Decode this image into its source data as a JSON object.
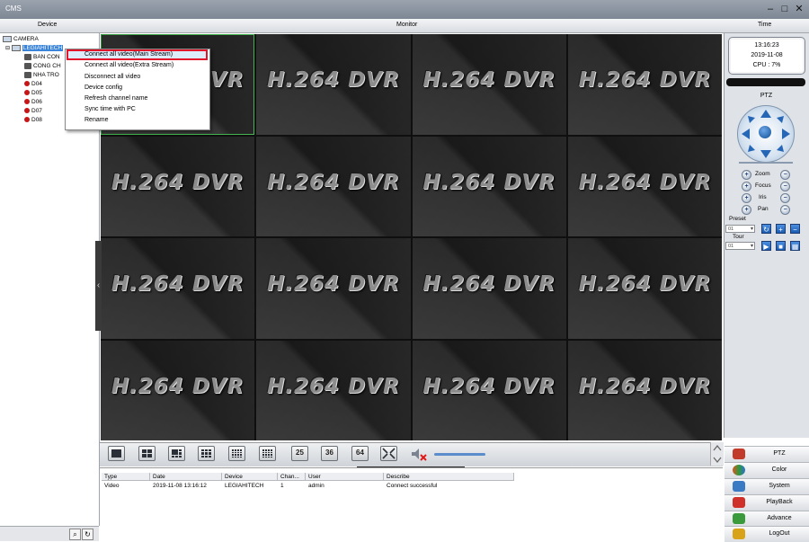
{
  "window": {
    "title": "CMS",
    "controls": {
      "minimize": "–",
      "maximize": "□",
      "close": "✕"
    }
  },
  "header": {
    "device": "Device",
    "monitor": "Monitor",
    "time": "Time"
  },
  "tree": {
    "root": "CAMERA",
    "device": "LEGIAHITECH",
    "channels": [
      "BAN CON",
      "CONG CH",
      "NHA TRO",
      "D04",
      "D05",
      "D06",
      "D07",
      "D08"
    ]
  },
  "context_menu": {
    "items": [
      "Connect all video(Main Stream)",
      "Connect all video(Extra Stream)",
      "Disconnect all video",
      "Device config",
      "Refresh channel name",
      "Sync time with PC",
      "Rename"
    ]
  },
  "video": {
    "placeholder": "H.264 DVR",
    "left_arrow": "‹"
  },
  "layout_buttons": {
    "n25": "25",
    "n36": "36",
    "n64": "64"
  },
  "log": {
    "columns": [
      "Type",
      "Date",
      "Device",
      "Chan...",
      "User",
      "Describe"
    ],
    "rows": [
      {
        "type": "Video",
        "date": "2019-11-08 13:16:12",
        "device": "LEGIAHITECH",
        "channel": "1",
        "user": "admin",
        "describe": "Connect successful"
      }
    ]
  },
  "clock": {
    "time": "13:16:23",
    "date": "2019-11-08",
    "cpu": "CPU : 7%"
  },
  "ptz": {
    "title": "PTZ",
    "controls": [
      "Zoom",
      "Focus",
      "Iris",
      "Pan"
    ],
    "preset_label": "Preset",
    "preset_value": "01",
    "tour_label": "Tour",
    "tour_value": "01"
  },
  "nav": {
    "items": [
      {
        "label": "PTZ",
        "color": "#c23a2a"
      },
      {
        "label": "Color",
        "color": "#e0531f"
      },
      {
        "label": "System",
        "color": "#3a79c4"
      },
      {
        "label": "PlayBack",
        "color": "#d0302a"
      },
      {
        "label": "Advance",
        "color": "#3b9a3b"
      },
      {
        "label": "LogOut",
        "color": "#d8a318"
      }
    ]
  },
  "colors": {
    "accent": "#3a84d9",
    "highlight_border": "#e3152a",
    "active_cell": "#3fb24b"
  }
}
